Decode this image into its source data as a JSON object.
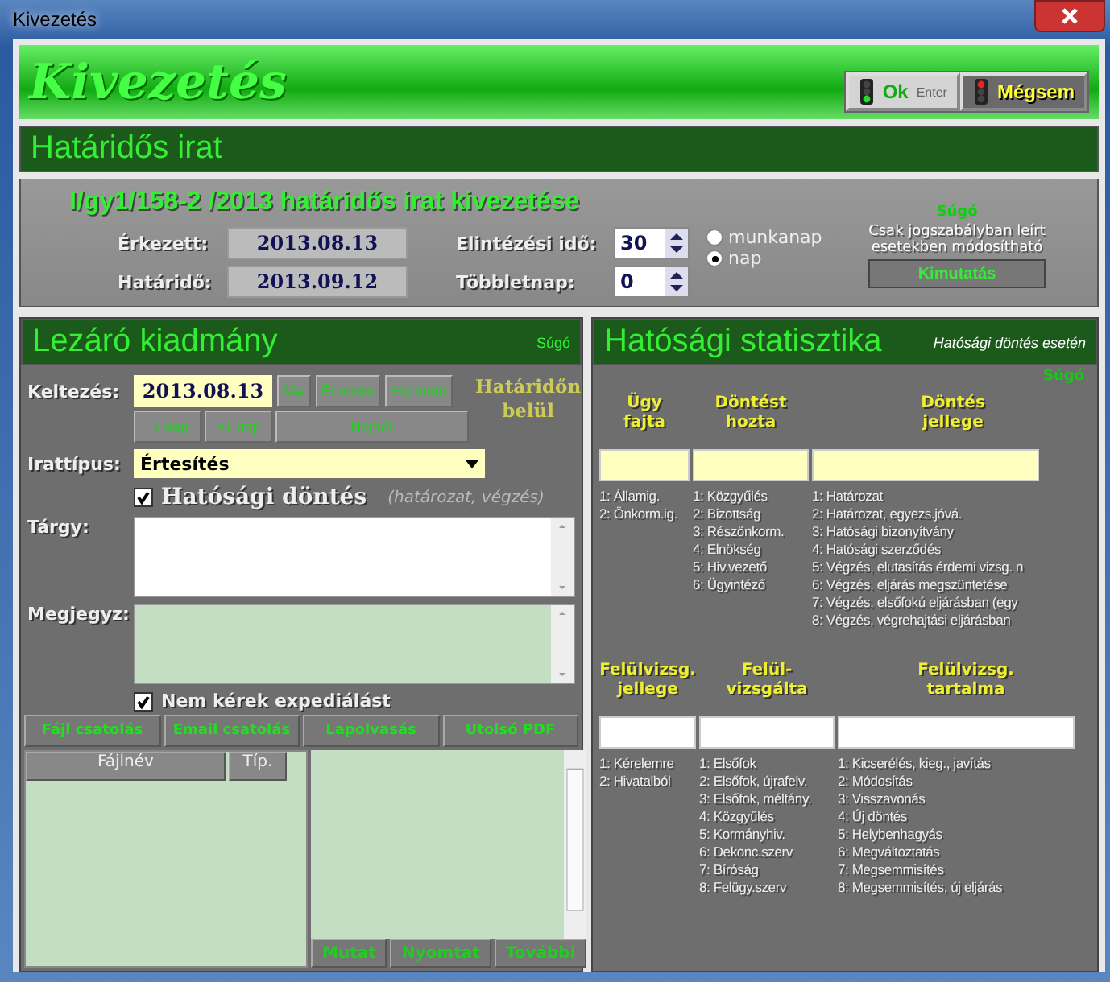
{
  "window": {
    "title": "Kivezetés"
  },
  "header": {
    "title": "Kivezetés",
    "ok_button": {
      "label": "Ok",
      "hint": "Enter"
    },
    "cancel_button": {
      "label": "Mégsem"
    }
  },
  "deadline_section": {
    "title": "Határidős irat",
    "document_title": "I/gy1/158-2 /2013 határidős irat kivezetése",
    "help": "Súgó",
    "received_label": "Érkezett:",
    "received_value": "2013.08.13",
    "deadline_label": "Határidő:",
    "deadline_value": "2013.09.12",
    "processing_time_label": "Elintézési idő:",
    "processing_time_value": "30",
    "extra_days_label": "Többletnap:",
    "extra_days_value": "0",
    "units": [
      {
        "label": "munkanap",
        "selected": false
      },
      {
        "label": "nap",
        "selected": true
      }
    ],
    "note": "Csak jogszabályban leírt esetekben módosítható",
    "report_button": "Kimutatás"
  },
  "closing": {
    "title": "Lezáró kiadmány",
    "help": "Súgó",
    "date_label": "Keltezés:",
    "date_value": "2013.08.13",
    "date_buttons": [
      "Ma",
      "Érkezés",
      "Határidő"
    ],
    "step_buttons": [
      "-1 nap",
      "+1 nap",
      "Naptár"
    ],
    "status": "Határidőn belül",
    "type_label": "Irattípus:",
    "type_value": "Értesítés",
    "authority_decision": {
      "label": "Hatósági döntés",
      "hint": "(határozat, végzés)",
      "checked": true
    },
    "subject_label": "Tárgy:",
    "remark_label": "Megjegyz:",
    "no_dispatch": {
      "label": "Nem kérek expediálást",
      "checked": true
    },
    "attach_buttons": [
      "Fájl csatolás",
      "Email csatolás",
      "Lapolvasás",
      "Utolsó PDF"
    ],
    "file_columns": [
      "Fájlnév",
      "Típ."
    ],
    "action_buttons": [
      "Mutat",
      "Nyomtat",
      "További"
    ]
  },
  "stats": {
    "title": "Hatósági statisztika",
    "subtitle": "Hatósági döntés esetén",
    "help": "Súgó",
    "groups": [
      {
        "columns": [
          {
            "heading": "Ügy\nfajta",
            "required": true,
            "options": [
              "1: Államig.",
              "2: Önkorm.ig."
            ]
          },
          {
            "heading": "Döntést\nhozta",
            "required": true,
            "options": [
              "1: Közgyűlés",
              "2: Bizottság",
              "3: Részönkorm.",
              "4: Elnökség",
              "5: Hiv.vezető",
              "6: Ügyintéző"
            ]
          },
          {
            "heading": "Döntés\njellege",
            "required": true,
            "options": [
              "1: Határozat",
              "2: Határozat, egyezs.jóvá.",
              "3: Hatósági bizonyítvány",
              "4: Hatósági szerződés",
              "5: Végzés, elutasítás érdemi vizsg. n",
              "6: Végzés, eljárás megszüntetése",
              "7: Végzés, elsőfokú eljárásban (egy",
              "8: Végzés, végrehajtási eljárásban"
            ]
          }
        ]
      },
      {
        "columns": [
          {
            "heading": "Felülvizsg.\njellege",
            "required": false,
            "options": [
              "1: Kérelemre",
              "2: Hivatalból"
            ]
          },
          {
            "heading": "Felül-\nvizsgálta",
            "required": false,
            "options": [
              "1: Elsőfok",
              "2: Elsőfok, újrafelv.",
              "3: Elsőfok, méltány.",
              "4: Közgyűlés",
              "5: Kormányhiv.",
              "6: Dekonc.szerv",
              "7: Bíróság",
              "8: Felügy.szerv"
            ]
          },
          {
            "heading": "Felülvizsg.\ntartalma",
            "required": false,
            "options": [
              "1: Kicserélés, kieg., javítás",
              "2: Módosítás",
              "3: Visszavonás",
              "4: Új döntés",
              "5: Helybenhagyás",
              "6: Megváltoztatás",
              "7: Megsemmisítés",
              "8: Megsemmisítés, új eljárás"
            ]
          }
        ]
      }
    ]
  }
}
